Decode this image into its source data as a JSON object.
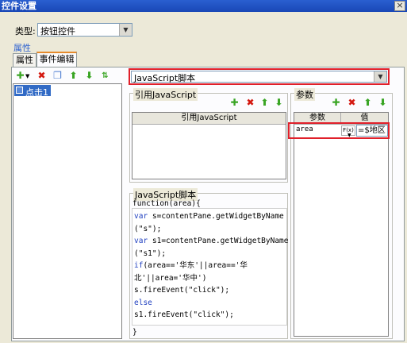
{
  "window": {
    "title": "控件设置",
    "close_label": "×"
  },
  "type_row": {
    "label": "类型:",
    "value": "按钮控件"
  },
  "section_title": "属性",
  "tabs": [
    "属性",
    "事件编辑"
  ],
  "event_list": {
    "items": [
      "点击1"
    ]
  },
  "script_type": {
    "value": "JavaScript脚本"
  },
  "ref_js": {
    "group_title": "引用JavaScript",
    "column": "引用JavaScript"
  },
  "params": {
    "group_title": "参数",
    "columns": [
      "参数",
      "值"
    ],
    "rows": [
      {
        "name": "area",
        "fx": "F(x)",
        "value": "=$地区"
      }
    ]
  },
  "js_script": {
    "group_title": "JavaScript脚本",
    "header": "function(area){",
    "lines": [
      {
        "kw": "var",
        "text": " s=contentPane.getWidgetByName"
      },
      {
        "kw": "",
        "text": "(\"s\");"
      },
      {
        "kw": "var",
        "text": " s1=contentPane.getWidgetByName"
      },
      {
        "kw": "",
        "text": "(\"s1\");"
      },
      {
        "kw": "if",
        "text": "(area=='华东'||area=='华"
      },
      {
        "kw": "",
        "text": "北'||area='华中')"
      },
      {
        "kw": "",
        "text": "s.fireEvent(\"click\");"
      },
      {
        "kw": "else",
        "text": ""
      },
      {
        "kw": "",
        "text": "s1.fireEvent(\"click\");"
      }
    ],
    "footer": "}"
  }
}
